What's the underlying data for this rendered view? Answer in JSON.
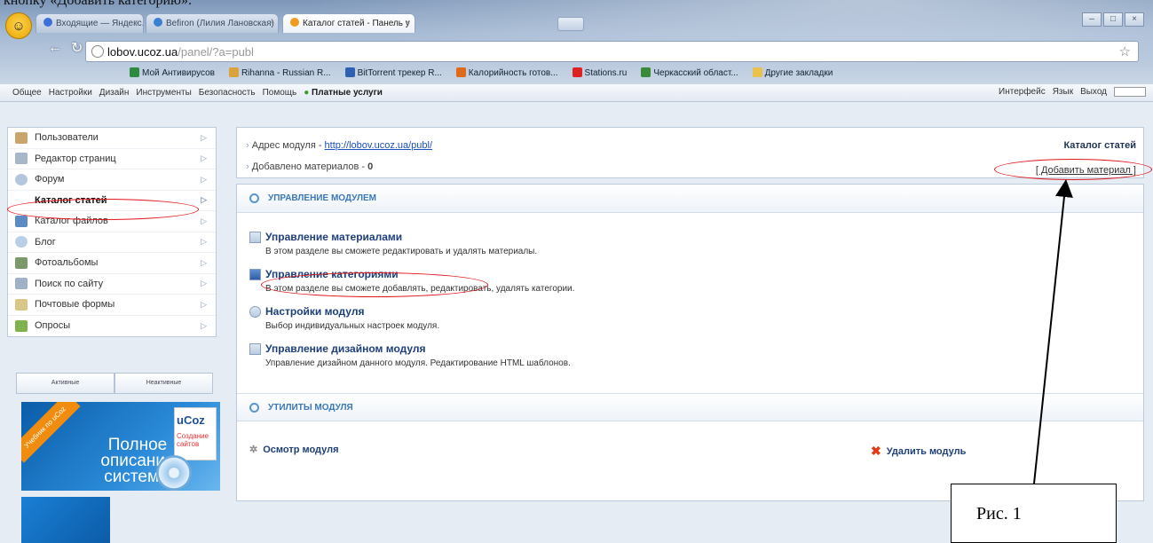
{
  "caption": "кнопку «Добавить категорию».",
  "browser": {
    "tabs": [
      {
        "label": "Входящие — Яндекс.Почта",
        "color": "#3d6fd8"
      },
      {
        "label": "Befiron (Лилия Лановская)",
        "color": "#3a7fd0"
      },
      {
        "label": "Каталог статей - Панель у",
        "color": "#f29a1e"
      }
    ],
    "url_host": "lobov.ucoz.ua",
    "url_path": "/panel/?a=publ",
    "bookmarks": [
      {
        "label": "Мой Антивирусов",
        "color": "#2d8a3e"
      },
      {
        "label": "Rihanna - Russian R...",
        "color": "#d9a23a"
      },
      {
        "label": "BitTorrent трекер R...",
        "color": "#2f5fb0"
      },
      {
        "label": "Калорийность готов...",
        "color": "#e06a1a"
      },
      {
        "label": "Stations.ru",
        "color": "#d22"
      },
      {
        "label": "Черкасский област...",
        "color": "#3a8a3a"
      },
      {
        "label": "Другие закладки",
        "color": "#e8c24a"
      }
    ]
  },
  "panel": {
    "menu": [
      "Общее",
      "Настройки",
      "Дизайн",
      "Инструменты",
      "Безопасность",
      "Помощь"
    ],
    "paid": "Платные услуги",
    "interface": "Интерфейс",
    "lang": "Язык",
    "exit": "Выход"
  },
  "sidebar": {
    "items": [
      {
        "label": "Пользователи",
        "color": "#c9a46b"
      },
      {
        "label": "Редактор страниц",
        "color": "#a7b6c9"
      },
      {
        "label": "Форум",
        "color": "#b4c6de"
      },
      {
        "label": "Каталог статей",
        "color": "#ffffff"
      },
      {
        "label": "Каталог файлов",
        "color": "#5a8bc5"
      },
      {
        "label": "Блог",
        "color": "#b9cfe8"
      },
      {
        "label": "Фотоальбомы",
        "color": "#7b9a6a"
      },
      {
        "label": "Поиск по сайту",
        "color": "#9fb2c8"
      },
      {
        "label": "Почтовые формы",
        "color": "#d9c78a"
      },
      {
        "label": "Опросы",
        "color": "#7fb24a"
      }
    ],
    "tab_active": "Активные",
    "tab_inactive": "Неактивные",
    "banner_ribbon": "Учебник по uCoz",
    "banner_text": "Полное описание системы",
    "banner_logo": "uCoz",
    "banner_logo_sub": "Создание сайтов"
  },
  "info": {
    "address_label": "Адрес модуля - ",
    "address_url": "http://lobov.ucoz.ua/publ/",
    "added_label": "Добавлено материалов - ",
    "added_count": "0",
    "module_title": "Каталог статей",
    "add_material": "[ Добавить материал ]"
  },
  "manage": {
    "section": "УПРАВЛЕНИЕ МОДУЛЕМ",
    "entries": [
      {
        "title": "Управление материалами",
        "desc": "В этом разделе вы сможете редактировать и удалять материалы."
      },
      {
        "title": "Управление категориями",
        "desc": "В этом разделе вы сможете добавлять, редактировать, удалять категории."
      },
      {
        "title": "Настройки модуля",
        "desc": "Выбор индивидуальных настроек модуля."
      },
      {
        "title": "Управление дизайном модуля",
        "desc": "Управление дизайном данного модуля. Редактирование HTML шаблонов."
      }
    ],
    "util_section": "УТИЛИТЫ МОДУЛЯ",
    "view_module": "Осмотр модуля",
    "delete_module": "Удалить модуль"
  },
  "callout": "Рис. 1",
  "colors": {
    "annotation": "#e0151c",
    "link": "#1b4fbd"
  }
}
